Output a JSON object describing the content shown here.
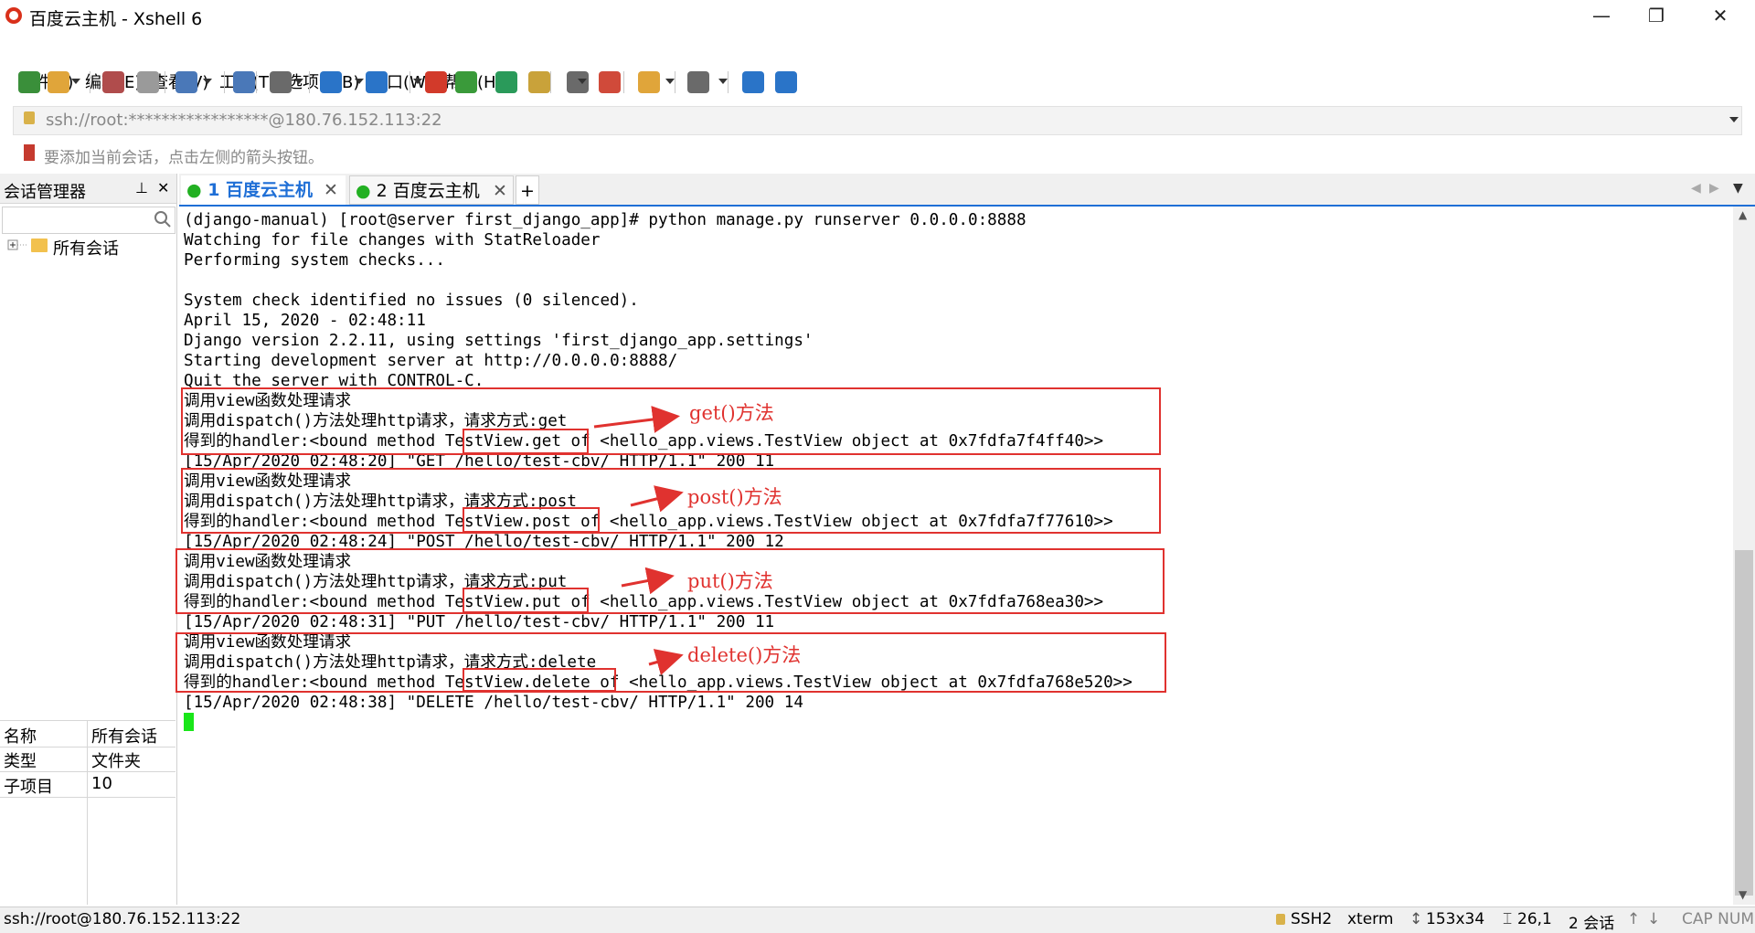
{
  "window": {
    "title": "百度云主机 - Xshell 6",
    "minimize_glyph": "—",
    "restore_glyph": "❐",
    "close_glyph": "✕"
  },
  "menu": [
    "文件(F)",
    "编辑(E)",
    "查看(V)",
    "工具(T)",
    "选项卡(B)",
    "窗口(W)",
    "帮助(H)"
  ],
  "toolbar_icons": [
    {
      "name": "new-session-icon",
      "color": "#3a8f3a"
    },
    {
      "name": "open-folder-icon",
      "color": "#e0a53a"
    },
    {
      "name": "connect-icon",
      "color": "#b04c4c"
    },
    {
      "name": "disconnect-icon",
      "color": "#9a9a9a"
    },
    {
      "name": "properties-icon",
      "color": "#4a78b8"
    },
    {
      "name": "find-icon",
      "color": "#4a78b8"
    },
    {
      "name": "copy-paste-icon",
      "color": "#6a6a6a"
    },
    {
      "name": "globe-icon",
      "color": "#2a74c8"
    },
    {
      "name": "font-icon",
      "color": "#2a74c8"
    },
    {
      "name": "xftp-icon",
      "color": "#d23a2a"
    },
    {
      "name": "xmanager-icon",
      "color": "#3a9a3a"
    },
    {
      "name": "fullscreen-icon",
      "color": "#2a9a5a"
    },
    {
      "name": "lock-icon",
      "color": "#c9a23a"
    },
    {
      "name": "keyboard-icon",
      "color": "#6a6a6a"
    },
    {
      "name": "highlight-icon",
      "color": "#d04a3a"
    },
    {
      "name": "new-tab-icon",
      "color": "#e0a53a"
    },
    {
      "name": "layout-icon",
      "color": "#6a6a6a"
    },
    {
      "name": "help-icon",
      "color": "#2a74c8"
    },
    {
      "name": "chat-icon",
      "color": "#2a74c8"
    }
  ],
  "address": "ssh://root:*****************@180.76.152.113:22",
  "hint": "要添加当前会话，点击左侧的箭头按钮。",
  "session_manager": {
    "title": "会话管理器",
    "pin_glyph": "⊥",
    "close_glyph": "✕",
    "tree_root": "所有会话",
    "properties": [
      {
        "key": "名称",
        "value": "所有会话"
      },
      {
        "key": "类型",
        "value": "文件夹"
      },
      {
        "key": "子项目",
        "value": "10"
      }
    ]
  },
  "tabs": [
    {
      "label": "1 百度云主机",
      "active": true
    },
    {
      "label": "2 百度云主机",
      "active": false
    }
  ],
  "add_tab_glyph": "+",
  "terminal_lines": [
    "(django-manual) [root@server first_django_app]# python manage.py runserver 0.0.0.0:8888",
    "Watching for file changes with StatReloader",
    "Performing system checks...",
    "",
    "System check identified no issues (0 silenced).",
    "April 15, 2020 - 02:48:11",
    "Django version 2.2.11, using settings 'first_django_app.settings'",
    "Starting development server at http://0.0.0.0:8888/",
    "Quit the server with CONTROL-C.",
    "调用view函数处理请求",
    "调用dispatch()方法处理http请求，请求方式:get",
    "得到的handler:<bound method TestView.get of <hello_app.views.TestView object at 0x7fdfa7f4ff40>>",
    "[15/Apr/2020 02:48:20] \"GET /hello/test-cbv/ HTTP/1.1\" 200 11",
    "调用view函数处理请求",
    "调用dispatch()方法处理http请求，请求方式:post",
    "得到的handler:<bound method TestView.post of <hello_app.views.TestView object at 0x7fdfa7f77610>>",
    "[15/Apr/2020 02:48:24] \"POST /hello/test-cbv/ HTTP/1.1\" 200 12",
    "调用view函数处理请求",
    "调用dispatch()方法处理http请求，请求方式:put",
    "得到的handler:<bound method TestView.put of <hello_app.views.TestView object at 0x7fdfa768ea30>>",
    "[15/Apr/2020 02:48:31] \"PUT /hello/test-cbv/ HTTP/1.1\" 200 11",
    "调用view函数处理请求",
    "调用dispatch()方法处理http请求，请求方式:delete",
    "得到的handler:<bound method TestView.delete of <hello_app.views.TestView object at 0x7fdfa768e520>>",
    "[15/Apr/2020 02:48:38] \"DELETE /hello/test-cbv/ HTTP/1.1\" 200 14"
  ],
  "annotations": [
    "get()方法",
    "post()方法",
    "put()方法",
    "delete()方法"
  ],
  "annotation_color": "#e0322f",
  "cursor_color": "#19e619",
  "status": {
    "connection": "ssh://root@180.76.152.113:22",
    "protocol": "SSH2",
    "terminal": "xterm",
    "size": "153x34",
    "position": "26,1",
    "sessions": "2 会话",
    "keys": "CAP NUM"
  }
}
